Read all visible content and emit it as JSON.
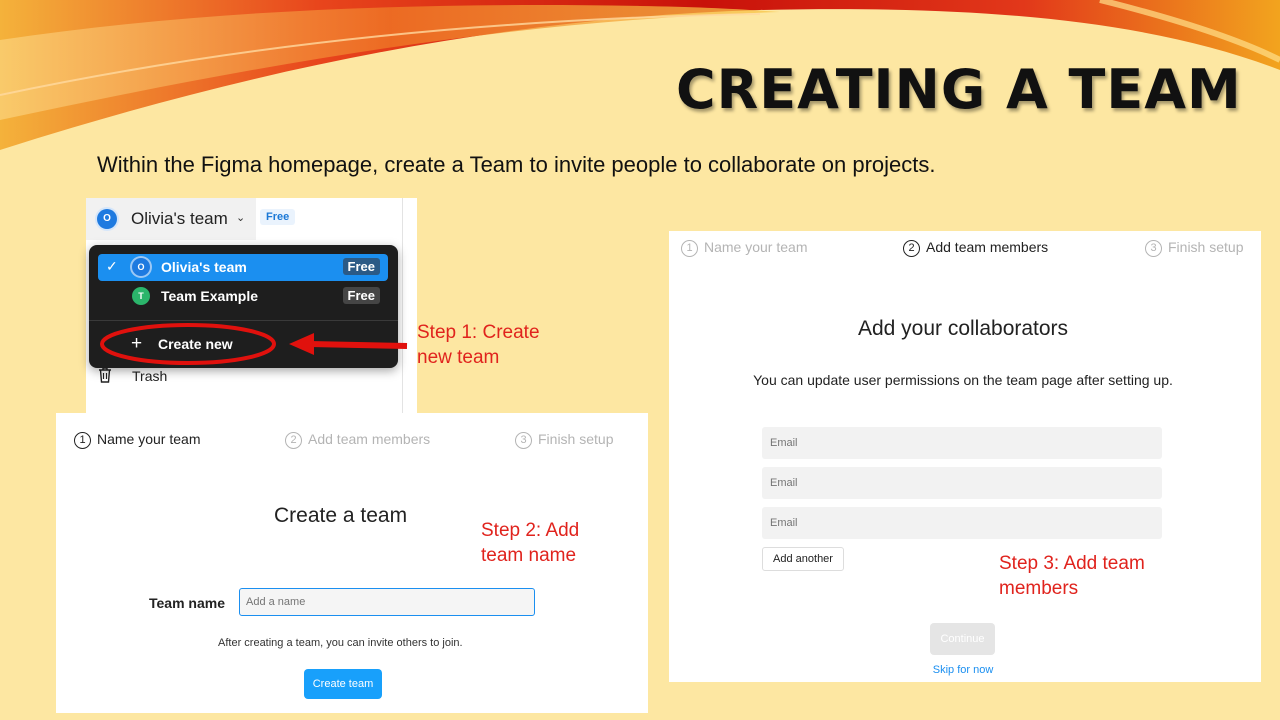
{
  "slide": {
    "title": "CREATING A TEAM",
    "subtitle": "Within the Figma homepage, create a Team to invite people to collaborate on projects."
  },
  "panel1": {
    "team_initial": "O",
    "team_name": "Olivia's team",
    "plan_chip": "Free",
    "menu": [
      {
        "initial": "O",
        "label": "Olivia's team",
        "badge": "Free",
        "selected": true,
        "avatar_color": "#1e7ae0"
      },
      {
        "initial": "T",
        "label": "Team Example",
        "badge": "Free",
        "selected": false,
        "avatar_color": "#2bb56b"
      }
    ],
    "create_new": "Create new",
    "trash": "Trash"
  },
  "annotations": {
    "step1": "Step 1: Create\nnew team",
    "step2": "Step 2: Add\nteam name",
    "step3": "Step 3: Add team\nmembers",
    "color": "#e0231d"
  },
  "steps": [
    {
      "num": "1",
      "label": "Name your team"
    },
    {
      "num": "2",
      "label": "Add team members"
    },
    {
      "num": "3",
      "label": "Finish setup"
    }
  ],
  "panel2": {
    "title": "Create a team",
    "field_label": "Team name",
    "placeholder": "Add a name",
    "hint": "After creating a team, you can invite others to join.",
    "button": "Create team"
  },
  "panel3": {
    "title": "Add your collaborators",
    "subtitle": "You can update user permissions on the team page after setting up.",
    "email_placeholder": "Email",
    "add_another": "Add another",
    "continue": "Continue",
    "skip": "Skip for now"
  }
}
